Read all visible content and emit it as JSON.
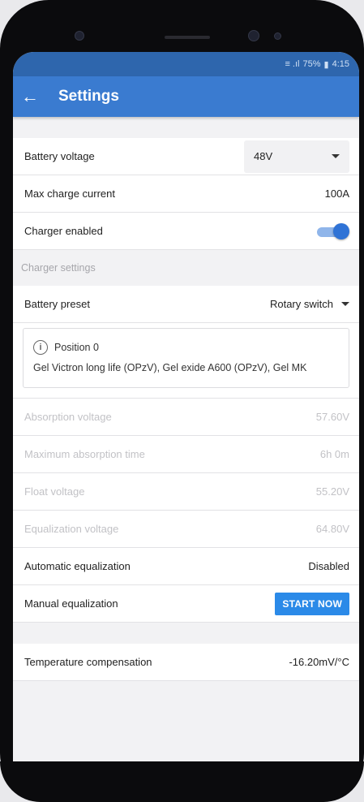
{
  "statusbar": {
    "signal_text": "≡ .ıl",
    "battery": "75%",
    "time": "4:15"
  },
  "appbar": {
    "back_icon": "←",
    "title": "Settings"
  },
  "battery_voltage": {
    "label": "Battery voltage",
    "value": "48V"
  },
  "max_charge_current": {
    "label": "Max charge current",
    "value": "100A"
  },
  "charger_enabled": {
    "label": "Charger enabled",
    "on": true
  },
  "charger_settings": {
    "header": "Charger settings"
  },
  "battery_preset": {
    "label": "Battery preset",
    "value": "Rotary switch"
  },
  "info_card": {
    "icon": "i",
    "title": "Position 0",
    "text": "Gel Victron long life (OPzV), Gel exide A600 (OPzV), Gel MK"
  },
  "absorption_voltage": {
    "label": "Absorption voltage",
    "value": "57.60V"
  },
  "max_absorption_time": {
    "label": "Maximum absorption time",
    "value": "6h 0m"
  },
  "float_voltage": {
    "label": "Float voltage",
    "value": "55.20V"
  },
  "equalization_voltage": {
    "label": "Equalization voltage",
    "value": "64.80V"
  },
  "automatic_equalization": {
    "label": "Automatic equalization",
    "value": "Disabled"
  },
  "manual_equalization": {
    "label": "Manual equalization",
    "button": "START NOW"
  },
  "temperature_compensation": {
    "label": "Temperature compensation",
    "value": "-16.20mV/°C"
  },
  "colors": {
    "primary": "#3a7bd0",
    "status": "#2e66ad",
    "accent": "#2b8ae8",
    "toggle": "#2f73d6"
  }
}
